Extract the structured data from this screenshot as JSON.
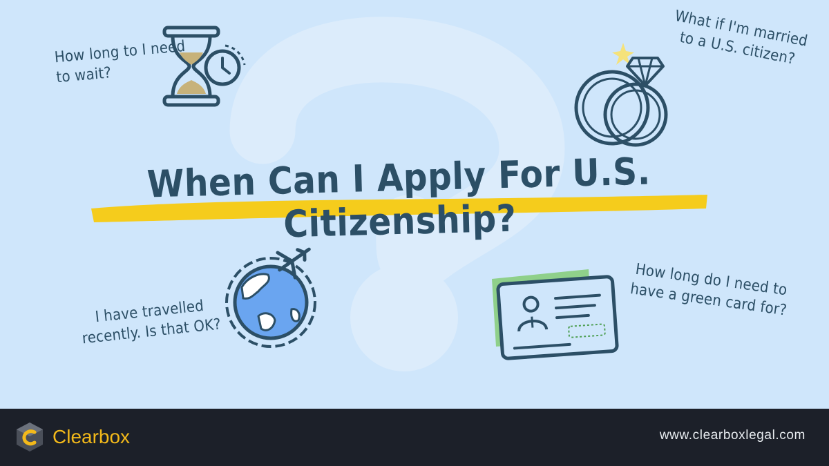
{
  "headline": "When Can I Apply For U.S. Citizenship?",
  "questions": {
    "wait": "How long to I need to wait?",
    "married": "What if I'm married to a U.S. citizen?",
    "travel": "I have travelled recently. Is that OK?",
    "green_card": "How long do I need to have a green card for?"
  },
  "icons": {
    "wait": "hourglass-clock-icon",
    "married": "wedding-rings-icon",
    "travel": "globe-airplane-icon",
    "green_card": "green-card-id-icon"
  },
  "footer": {
    "brand": "Clearbox",
    "website": "www.clearboxlegal.com"
  },
  "colors": {
    "background": "#cfe6fb",
    "ink": "#2c4f66",
    "highlight": "#f5cc1c",
    "footer": "#1c2029",
    "brand": "#f3b91a",
    "globe": "#6aa5f0",
    "card_green": "#8fd08a"
  }
}
